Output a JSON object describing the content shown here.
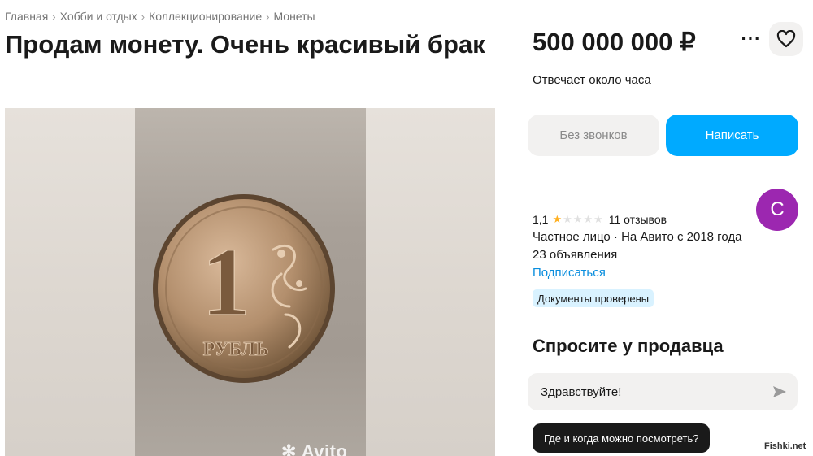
{
  "breadcrumb": [
    "Главная",
    "Хобби и отдых",
    "Коллекционирование",
    "Монеты"
  ],
  "listing": {
    "title": "Продам монету. Очень красивый брак",
    "price": "500 000 000 ₽",
    "response_time": "Отвечает около часа"
  },
  "photo": {
    "coin_value": "1",
    "coin_word": "РУБЛЬ",
    "watermark": "Avito"
  },
  "actions": {
    "more_icon": "more-icon",
    "favorite_icon": "heart-icon",
    "no_calls_label": "Без звонков",
    "write_label": "Написать"
  },
  "seller": {
    "avatar_letter": "С",
    "rating": "1,1",
    "stars_filled": 1,
    "stars_total": 5,
    "reviews": "11 отзывов",
    "info": "Частное лицо · На Авито с 2018 года",
    "ads_count": "23 объявления",
    "subscribe_label": "Подписаться",
    "docs_badge": "Документы проверены"
  },
  "ask": {
    "title": "Спросите у продавца",
    "message_value": "Здравствуйте!",
    "quick_question": "Где и когда можно посмотреть?"
  },
  "site_watermark": "Fishki.net",
  "colors": {
    "accent": "#00aaff",
    "avatar": "#9c27b0",
    "star": "#ffb021",
    "link": "#0a8ede",
    "badge": "#d9f2ff"
  }
}
